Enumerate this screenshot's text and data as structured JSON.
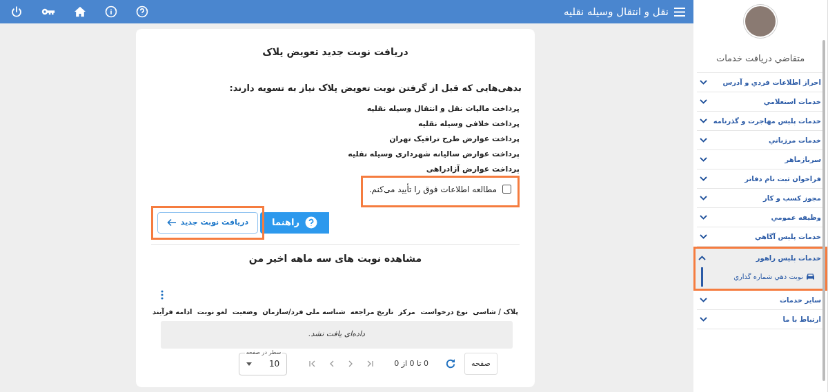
{
  "topbar": {
    "title": "نقل و انتقال وسيله نقليه"
  },
  "card": {
    "title": "دریافت نوبت جدید تعویض پلاک",
    "intro": "بدهی‌هایی که قبل از گرفتن نوبت تعویض پلاک نیاز به تسویه دارند:",
    "debts": [
      "پرداخت مالیات نقل و انتقال وسیله نقلیه",
      "پرداخت خلافی وسیله نقلیه",
      "پرداخت عوارض طرح ترافیک تهران",
      "پرداخت عوارض سالیانه شهرداری وسیله نقلیه",
      "پرداخت عوارض آزادراهی"
    ],
    "confirm": {
      "label": "مطالعه اطلاعات فوق را تأیید می‌کنم.",
      "checked": false,
      "highlighted": true
    },
    "help_button": "راهنما",
    "new_button": {
      "label": "دریافت نوبت جدید",
      "highlighted": true
    }
  },
  "history": {
    "title": "مشاهده نوبت های سه ماهه اخیر من",
    "columns": [
      "پلاک / شاسی",
      "نوع درخواست",
      "مرکز",
      "تاریخ مراجعه",
      "شناسه ملی فرد/سازمان",
      "وضعیت",
      "لغو نوبت",
      "ادامه فرآیند"
    ],
    "empty": "داده‌ای یافت نشد.",
    "page_button": "صفحه",
    "range": "0 تا 0 از 0",
    "rows_label": "سطر در صفحه",
    "rows_value": "10"
  },
  "sidebar": {
    "role": "متقاضي دريافت خدمات",
    "items": [
      {
        "label": "احراز اطلاعات فردي و آدرس",
        "expanded": false,
        "highlighted": false
      },
      {
        "label": "خدمات استعلامي",
        "expanded": false,
        "highlighted": false
      },
      {
        "label": "خدمات پليس مهاجرت و گذرنامه",
        "expanded": false,
        "highlighted": false
      },
      {
        "label": "خدمات مرزباني",
        "expanded": false,
        "highlighted": false
      },
      {
        "label": "سربازماهر",
        "expanded": false,
        "highlighted": false
      },
      {
        "label": "فراخوان ثبت نام دفاتر",
        "expanded": false,
        "highlighted": false
      },
      {
        "label": "مجوز كسب و كار",
        "expanded": false,
        "highlighted": false
      },
      {
        "label": "وظيفه عمومي",
        "expanded": false,
        "highlighted": false
      },
      {
        "label": "خدمات پليس آگاهي",
        "expanded": false,
        "highlighted": false
      },
      {
        "label": "خدمات پليس راهور",
        "expanded": true,
        "highlighted": true,
        "children": [
          {
            "label": "نوبت دهي شماره گذاري",
            "selected": true
          }
        ]
      },
      {
        "label": "ساير خدمات",
        "expanded": false,
        "highlighted": false
      },
      {
        "label": "ارتباط با ما",
        "expanded": false,
        "highlighted": false
      }
    ]
  }
}
